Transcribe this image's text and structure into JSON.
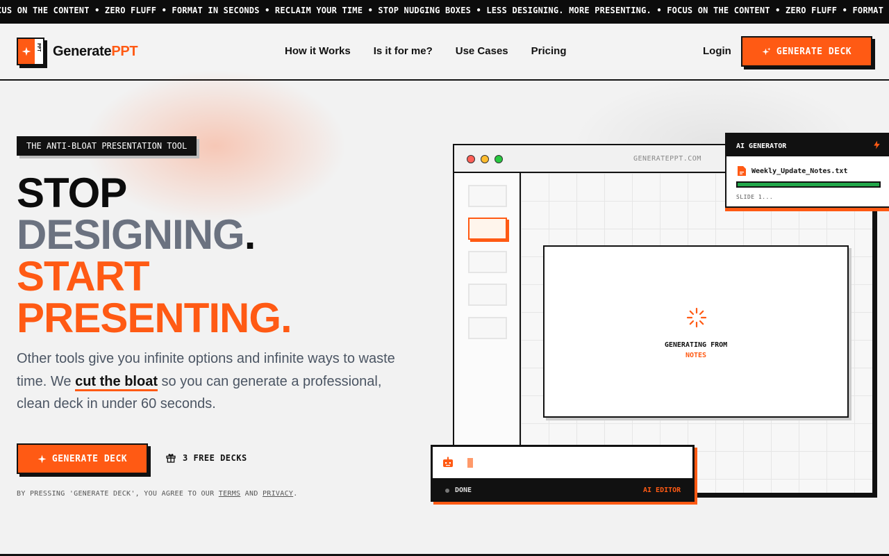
{
  "ticker": {
    "text": "CUS ON THE CONTENT • ZERO FLUFF • FORMAT IN SECONDS • RECLAIM YOUR TIME • STOP NUDGING BOXES • LESS DESIGNING. MORE PRESENTING. • FOCUS ON THE CONTENT • ZERO FLUFF • FORMAT IN SECONDS"
  },
  "header": {
    "logo_mark": "PPT",
    "logo_text_main": "Generate",
    "logo_text_accent": "PPT",
    "nav": [
      {
        "label": "How it Works"
      },
      {
        "label": "Is it for me?"
      },
      {
        "label": "Use Cases"
      },
      {
        "label": "Pricing"
      }
    ],
    "login": "Login",
    "cta": "GENERATE DECK"
  },
  "hero": {
    "badge": "THE ANTI-BLOAT PRESENTATION TOOL",
    "line1": "STOP",
    "line2": "DESIGNING",
    "line2_dot": ".",
    "line3": "START",
    "line4": "PRESENTING.",
    "sub_before": "Other tools give you infinite options and infinite ways to waste time. We ",
    "sub_highlight": "cut the bloat",
    "sub_after": " so you can generate a professional, clean deck in under 60 seconds.",
    "cta": "GENERATE DECK",
    "free": "3 FREE DECKS",
    "legal_before": "BY PRESSING 'GENERATE DECK', YOU AGREE TO OUR ",
    "legal_terms": "TERMS",
    "legal_and": " AND ",
    "legal_privacy": "PRIVACY",
    "legal_end": "."
  },
  "mockup": {
    "url": "GENERATEPPT.COM",
    "dots": [
      "#ff5f57",
      "#febc2e",
      "#28c840"
    ],
    "generating_line1": "GENERATING FROM",
    "generating_line2": "NOTES",
    "ai_card": {
      "title": "AI GENERATOR",
      "file": "Weekly_Update_Notes.txt",
      "progress": 1.0,
      "slide_label": "SLIDE 1..."
    },
    "editor": {
      "status": "DONE",
      "tag": "AI EDITOR"
    }
  },
  "colors": {
    "accent": "#ff5a14",
    "gray_text": "#6b7280",
    "progress": "#22a74a"
  }
}
